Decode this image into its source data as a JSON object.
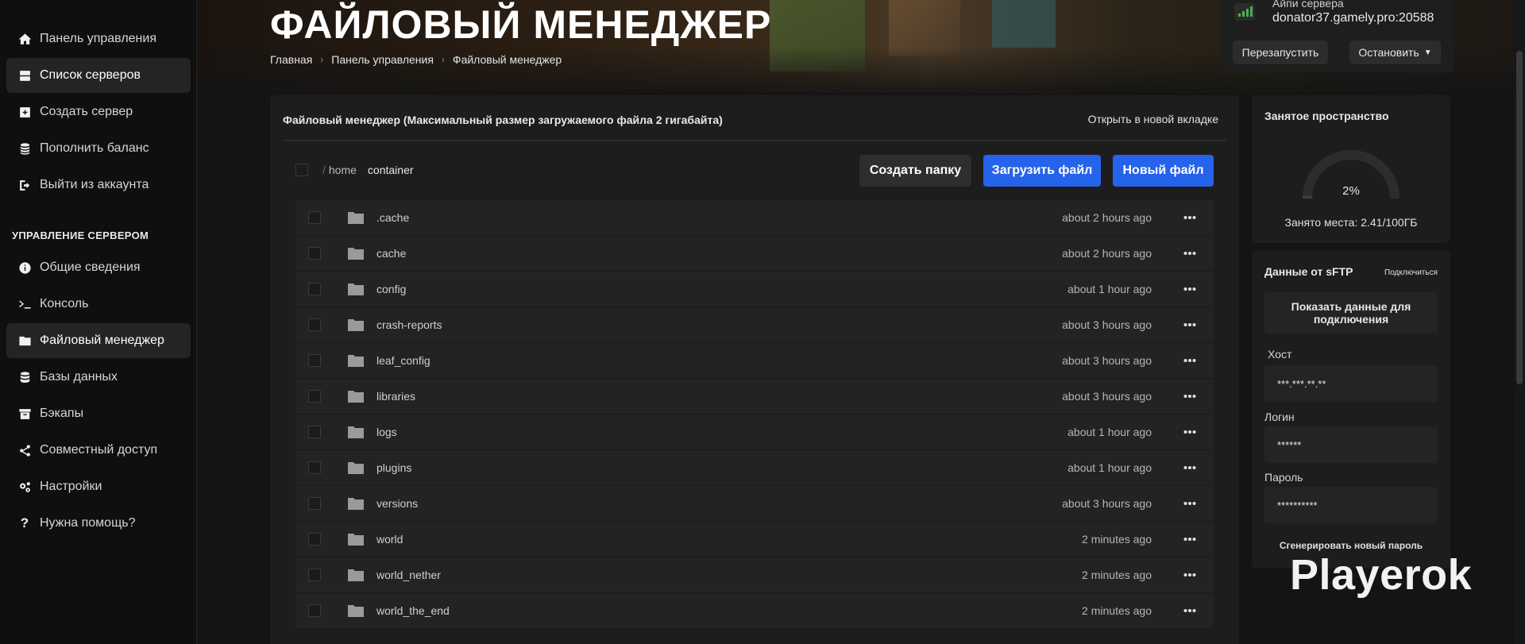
{
  "sidebar": {
    "items": [
      {
        "label": "Панель управления",
        "icon": "home-icon",
        "active": false
      },
      {
        "label": "Список серверов",
        "icon": "server-list-icon",
        "active": true
      },
      {
        "label": "Создать сервер",
        "icon": "plus-square-icon",
        "active": false
      },
      {
        "label": "Пополнить баланс",
        "icon": "coins-icon",
        "active": false
      },
      {
        "label": "Выйти из аккаунта",
        "icon": "logout-icon",
        "active": false
      }
    ],
    "section_title": "УПРАВЛЕНИЕ СЕРВЕРОМ",
    "server_items": [
      {
        "label": "Общие сведения",
        "icon": "info-icon",
        "active": false
      },
      {
        "label": "Консоль",
        "icon": "terminal-icon",
        "active": false
      },
      {
        "label": "Файловый менеджер",
        "icon": "folder-icon",
        "active": true
      },
      {
        "label": "Базы данных",
        "icon": "database-icon",
        "active": false
      },
      {
        "label": "Бэкапы",
        "icon": "archive-icon",
        "active": false
      },
      {
        "label": "Совместный доступ",
        "icon": "share-icon",
        "active": false
      },
      {
        "label": "Настройки",
        "icon": "gears-icon",
        "active": false
      },
      {
        "label": "Нужна помощь?",
        "icon": "question-icon",
        "active": false
      }
    ]
  },
  "header": {
    "title": "ФАЙЛОВЫЙ МЕНЕДЖЕР",
    "breadcrumb": [
      "Главная",
      "Панель управления",
      "Файловый менеджер"
    ]
  },
  "server": {
    "label": "Айпи сервера",
    "address": "donator37.gamely.pro:20588",
    "restart_label": "Перезапустить",
    "stop_label": "Остановить"
  },
  "file_manager": {
    "panel_title": "Файловый менеджер (Максимальный размер загружаемого файла 2 гигабайта)",
    "open_new_tab": "Открыть в новой вкладке",
    "path": {
      "separator": "/",
      "home": "home",
      "current": "container"
    },
    "buttons": {
      "create_folder": "Создать папку",
      "upload": "Загрузить файл",
      "new_file": "Новый файл"
    },
    "files": [
      {
        "name": ".cache",
        "modified": "about 2 hours ago"
      },
      {
        "name": "cache",
        "modified": "about 2 hours ago"
      },
      {
        "name": "config",
        "modified": "about 1 hour ago"
      },
      {
        "name": "crash-reports",
        "modified": "about 3 hours ago"
      },
      {
        "name": "leaf_config",
        "modified": "about 3 hours ago"
      },
      {
        "name": "libraries",
        "modified": "about 3 hours ago"
      },
      {
        "name": "logs",
        "modified": "about 1 hour ago"
      },
      {
        "name": "plugins",
        "modified": "about 1 hour ago"
      },
      {
        "name": "versions",
        "modified": "about 3 hours ago"
      },
      {
        "name": "world",
        "modified": "2 minutes ago"
      },
      {
        "name": "world_nether",
        "modified": "2 minutes ago"
      },
      {
        "name": "world_the_end",
        "modified": "2 minutes ago"
      }
    ]
  },
  "storage": {
    "title": "Занятое пространство",
    "percent_label": "2%",
    "percent": 2,
    "used_label": "Занято места: 2.41/100ГБ"
  },
  "sftp": {
    "title": "Данные от sFTP",
    "connect_label": "Подключиться",
    "show_label": "Показать данные для подключения",
    "host_label": "Хост",
    "host_value": "***.***.**.**",
    "login_label": "Логин",
    "login_value": "******",
    "password_label": "Пароль",
    "password_value": "**********",
    "generate_label": "Сгенерировать новый пароль"
  },
  "watermark": "Playerok",
  "colors": {
    "accent": "#2563eb",
    "signal": "#4caf50",
    "background": "#141414"
  }
}
